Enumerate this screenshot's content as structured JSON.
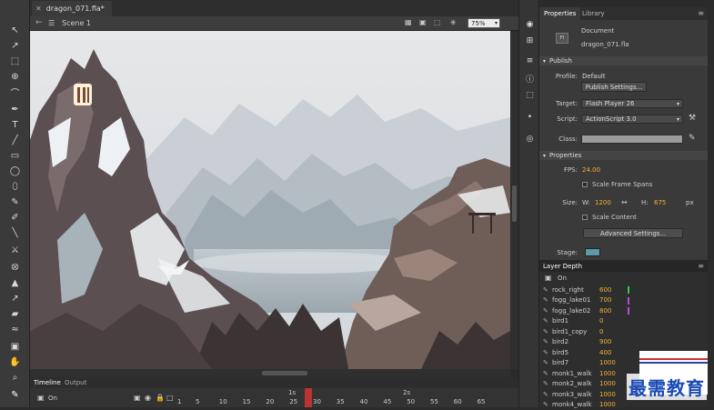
{
  "doc_tab": {
    "title": "dragon_071.fla*"
  },
  "scene_bar": {
    "scene": "Scene 1",
    "zoom": "75%"
  },
  "panel_tabs": {
    "properties": "Properties",
    "library": "Library"
  },
  "document": {
    "type_label": "Document",
    "filename": "dragon_071.fla"
  },
  "publish": {
    "header": "Publish",
    "profile_label": "Profile:",
    "profile_value": "Default",
    "settings_button": "Publish Settings...",
    "target_label": "Target:",
    "target_value": "Flash Player 26",
    "script_label": "Script:",
    "script_value": "ActionScript 3.0",
    "class_label": "Class:"
  },
  "properties": {
    "header": "Properties",
    "fps_label": "FPS:",
    "fps_value": "24.00",
    "scale_frame_spans": "Scale Frame Spans",
    "size_label": "Size:",
    "w_label": "W:",
    "w_value": "1200",
    "h_label": "H:",
    "h_value": "675",
    "unit": "px",
    "scale_content": "Scale Content",
    "advanced_button": "Advanced Settings...",
    "stage_label": "Stage:",
    "stage_color": "#5b9aa6"
  },
  "layer_depth": {
    "title": "Layer Depth",
    "on_label": "On",
    "layers": [
      {
        "name": "rock_right",
        "value": "600",
        "color": "#2ecc40"
      },
      {
        "name": "fogg_lake01",
        "value": "700",
        "color": "#b84ad6"
      },
      {
        "name": "fogg_lake02",
        "value": "800",
        "color": "#b84ad6"
      },
      {
        "name": "bird1",
        "value": "0",
        "color": ""
      },
      {
        "name": "bird1_copy",
        "value": "0",
        "color": ""
      },
      {
        "name": "bird2",
        "value": "900",
        "color": ""
      },
      {
        "name": "bird5",
        "value": "400",
        "color": ""
      },
      {
        "name": "bird7",
        "value": "1000",
        "color": ""
      },
      {
        "name": "monk1_walk",
        "value": "1000",
        "color": ""
      },
      {
        "name": "monk2_walk",
        "value": "1000",
        "color": ""
      },
      {
        "name": "monk3_walk",
        "value": "1000",
        "color": ""
      },
      {
        "name": "monk4_walk",
        "value": "1000",
        "color": ""
      }
    ]
  },
  "timeline": {
    "tabs": [
      "Timeline",
      "Output"
    ],
    "on_label": "On",
    "frame_numbers": [
      "1",
      "5",
      "10",
      "15",
      "20",
      "25",
      "30",
      "35",
      "40",
      "45",
      "50",
      "55",
      "60",
      "65"
    ],
    "second_marks": [
      "1s",
      "2s"
    ]
  },
  "watermark": "最需教育"
}
